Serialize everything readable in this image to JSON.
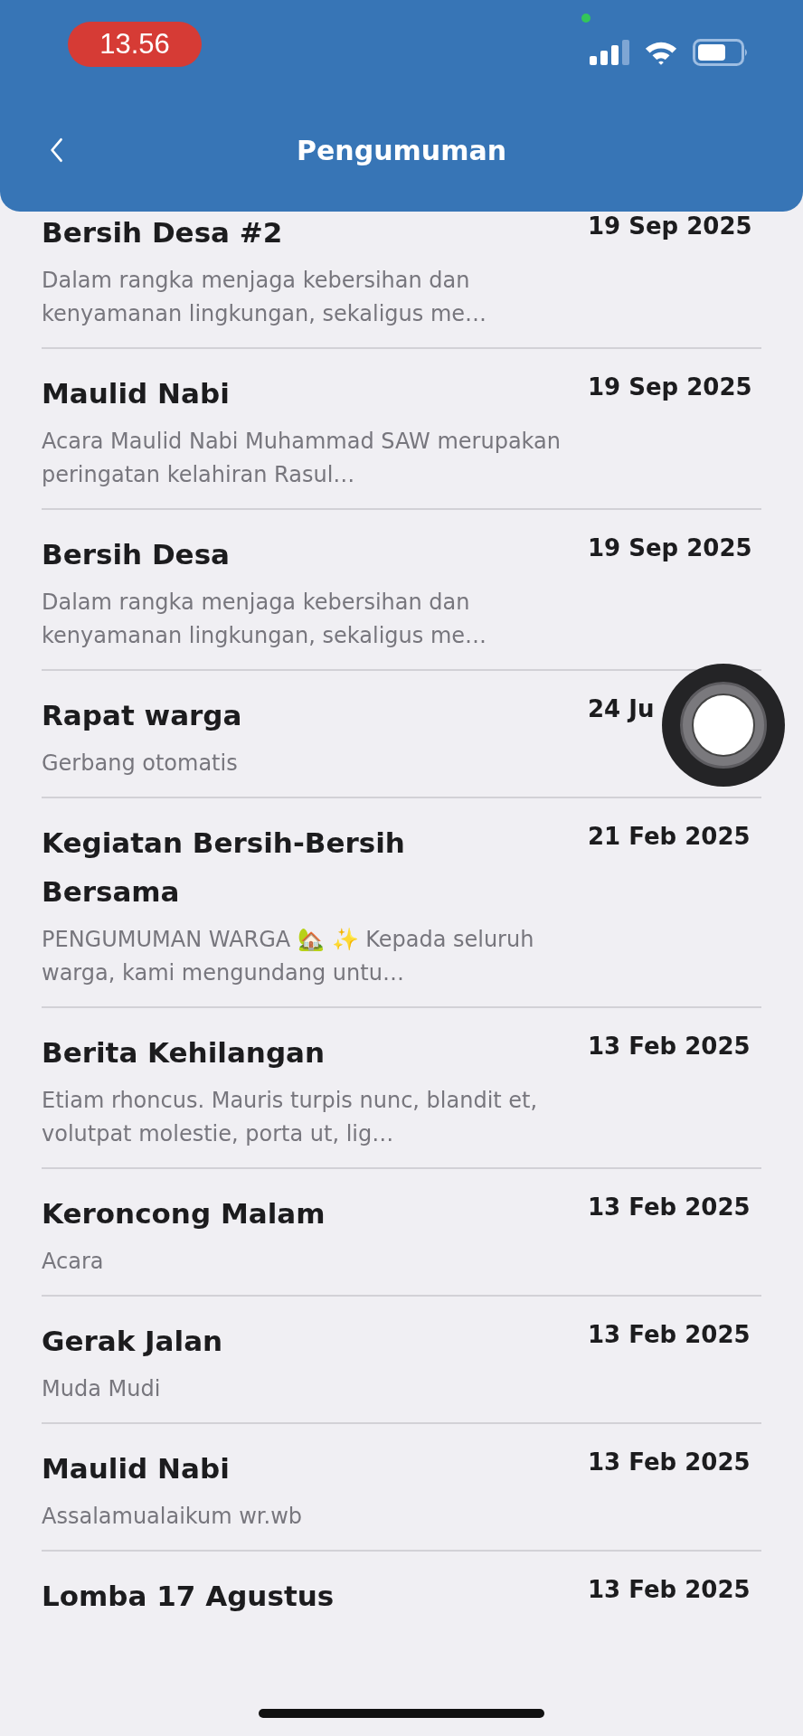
{
  "status_bar": {
    "time": "13.56"
  },
  "header": {
    "title": "Pengumuman"
  },
  "announcements": [
    {
      "title": "Bersih Desa #2",
      "date": "19 Sep 2025",
      "description": "Dalam rangka menjaga kebersihan dan kenyamanan lingkungan, sekaligus me…"
    },
    {
      "title": "Maulid Nabi",
      "date": "19 Sep 2025",
      "description": "Acara Maulid Nabi Muhammad SAW merupakan peringatan kelahiran Rasul…"
    },
    {
      "title": "Bersih Desa",
      "date": "19 Sep 2025",
      "description": "Dalam rangka menjaga kebersihan dan kenyamanan lingkungan, sekaligus me…"
    },
    {
      "title": "Rapat warga",
      "date": "24 Ju",
      "description": "Gerbang otomatis"
    },
    {
      "title": "Kegiatan Bersih-Bersih Bersama",
      "date": "21 Feb 2025",
      "description": "PENGUMUMAN WARGA 🏡 ✨ Kepada seluruh warga, kami mengundang untu…"
    },
    {
      "title": "Berita Kehilangan",
      "date": "13 Feb 2025",
      "description": "Etiam rhoncus. Mauris turpis nunc, blandit et, volutpat molestie, porta ut, lig…"
    },
    {
      "title": "Keroncong Malam",
      "date": "13 Feb 2025",
      "description": "Acara"
    },
    {
      "title": "Gerak Jalan",
      "date": "13 Feb 2025",
      "description": "Muda Mudi"
    },
    {
      "title": "Maulid Nabi",
      "date": "13 Feb 2025",
      "description": "Assalamualaikum wr.wb"
    },
    {
      "title": "Lomba 17 Agustus",
      "date": "13 Feb 2025"
    }
  ]
}
